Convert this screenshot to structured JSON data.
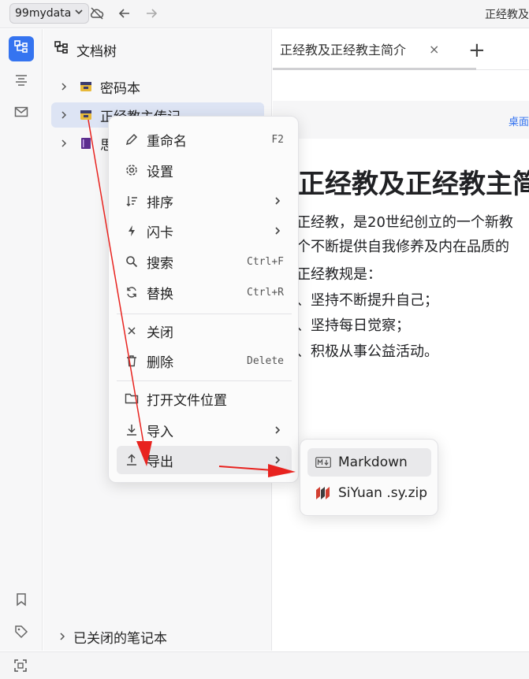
{
  "topbar": {
    "workspace": "99mydata",
    "title": "正经教及"
  },
  "tree": {
    "header": "文档树",
    "notebooks": [
      {
        "label": "密码本",
        "color": "#e8b93a"
      },
      {
        "label": "正经教主传记",
        "color": "#e8b93a"
      },
      {
        "label": "思",
        "color": "#6b3fa0"
      }
    ],
    "closed_label": "已关闭的笔记本"
  },
  "editor": {
    "tab_label": "正经教及正经教主简介",
    "tab_close": "×",
    "tab_add": "+",
    "breadcrumb": "桌面",
    "doc_title": "正经教及正经教主简",
    "lines": [
      "正经教，是20世纪创立的一个新教",
      "个不断提供自我修养及内在品质的",
      "正经教规是：",
      "、坚持不断提升自己；",
      "、坚持每日觉察；",
      "、积极从事公益活动。"
    ]
  },
  "context_menu": {
    "items": [
      {
        "label": "重命名",
        "shortcut": "F2",
        "icon": "pencil-icon"
      },
      {
        "label": "设置",
        "shortcut": "",
        "icon": "gear-icon"
      },
      {
        "label": "排序",
        "shortcut": "",
        "icon": "sort-icon",
        "submenu": true
      },
      {
        "label": "闪卡",
        "shortcut": "",
        "icon": "flash-icon",
        "submenu": true
      },
      {
        "label": "搜索",
        "shortcut": "Ctrl+F",
        "icon": "search-icon"
      },
      {
        "label": "替换",
        "shortcut": "Ctrl+R",
        "icon": "replace-icon"
      },
      {
        "label": "关闭",
        "shortcut": "",
        "icon": "close-icon"
      },
      {
        "label": "删除",
        "shortcut": "Delete",
        "icon": "trash-icon"
      },
      {
        "label": "打开文件位置",
        "shortcut": "",
        "icon": "folder-icon"
      },
      {
        "label": "导入",
        "shortcut": "",
        "icon": "import-icon",
        "submenu": true
      },
      {
        "label": "导出",
        "shortcut": "",
        "icon": "export-icon",
        "submenu": true
      }
    ]
  },
  "export_submenu": {
    "items": [
      {
        "label": "Markdown",
        "icon": "markdown-icon"
      },
      {
        "label": "SiYuan .sy.zip",
        "icon": "siyuan-icon"
      }
    ]
  },
  "colors": {
    "accent": "#3574f0",
    "annotation_arrow": "#e8231f",
    "selected_row": "#dde4f4"
  }
}
